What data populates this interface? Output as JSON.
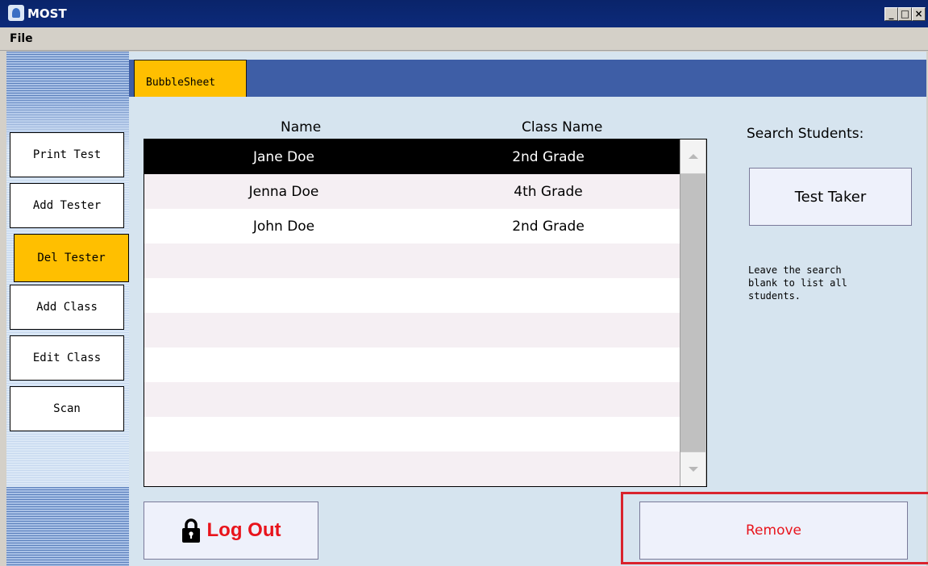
{
  "window": {
    "title": "MOST",
    "controls": [
      "minimize-icon",
      "maximize-icon",
      "close-icon"
    ]
  },
  "menubar": {
    "file": "File"
  },
  "sidebar": {
    "buttons": [
      {
        "label": "Print Test",
        "active": false
      },
      {
        "label": "Add Tester",
        "active": false
      },
      {
        "label": "Del Tester",
        "active": true
      },
      {
        "label": "Add Class",
        "active": false
      },
      {
        "label": "Edit Class",
        "active": false
      },
      {
        "label": "Scan",
        "active": false
      }
    ]
  },
  "tabs": [
    {
      "label": "BubbleSheet",
      "active": true
    }
  ],
  "table": {
    "headers": {
      "name": "Name",
      "class_name": "Class Name"
    },
    "rows": [
      {
        "name": "Jane Doe",
        "class_name": "2nd Grade",
        "selected": true
      },
      {
        "name": "Jenna Doe",
        "class_name": "4th Grade",
        "selected": false
      },
      {
        "name": "John Doe",
        "class_name": "2nd Grade",
        "selected": false
      }
    ]
  },
  "search": {
    "label": "Search Students:",
    "button": "Test Taker",
    "hint": "Leave the search blank to list all students."
  },
  "actions": {
    "logout": "Log Out",
    "remove": "Remove"
  },
  "colors": {
    "accent": "#ffbf00",
    "tab_bar": "#3e5ea6",
    "danger": "#e8141c",
    "highlight": "#d9232d",
    "panel": "#d6e4ef"
  }
}
